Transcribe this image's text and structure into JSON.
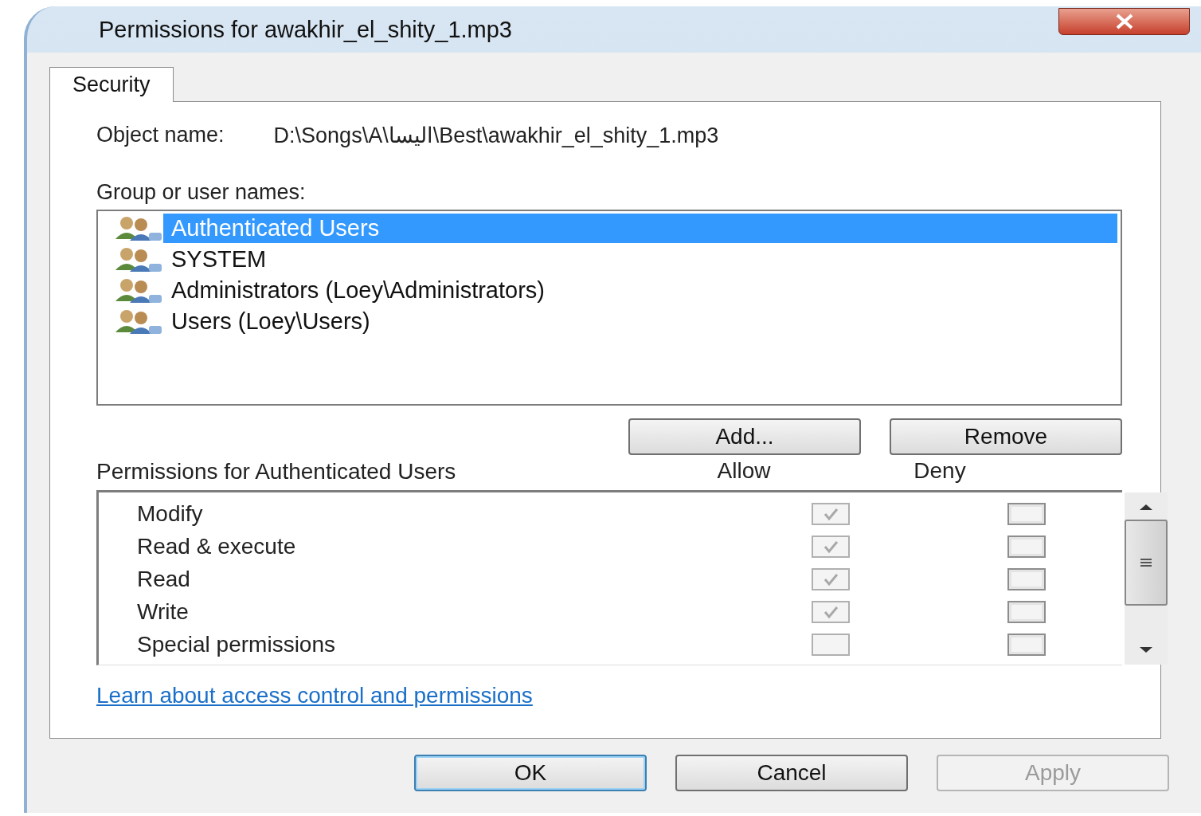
{
  "window": {
    "title": "Permissions for awakhir_el_shity_1.mp3"
  },
  "tabs": [
    {
      "label": "Security",
      "selected": true
    }
  ],
  "object_name": {
    "label": "Object name:",
    "value": "D:\\Songs\\A\\اليسا\\Best\\awakhir_el_shity_1.mp3"
  },
  "group_list": {
    "label": "Group or user names:",
    "items": [
      {
        "name": "Authenticated Users",
        "selected": true
      },
      {
        "name": "SYSTEM",
        "selected": false
      },
      {
        "name": "Administrators (Loey\\Administrators)",
        "selected": false
      },
      {
        "name": "Users (Loey\\Users)",
        "selected": false
      }
    ]
  },
  "group_buttons": [
    {
      "label": "Add...",
      "disabled": false
    },
    {
      "label": "Remove",
      "disabled": false
    }
  ],
  "permissions": {
    "label": "Permissions for Authenticated Users",
    "allow_header": "Allow",
    "deny_header": "Deny",
    "rows": [
      {
        "name": "Modify",
        "allow": true,
        "deny": false,
        "disabled": true
      },
      {
        "name": "Read & execute",
        "allow": true,
        "deny": false,
        "disabled": true
      },
      {
        "name": "Read",
        "allow": true,
        "deny": false,
        "disabled": true
      },
      {
        "name": "Write",
        "allow": true,
        "deny": false,
        "disabled": true
      },
      {
        "name": "Special permissions",
        "allow": false,
        "deny": false,
        "disabled": true
      }
    ]
  },
  "link": "Learn about access control and permissions",
  "buttons": [
    {
      "label": "OK",
      "disabled": false,
      "default": true
    },
    {
      "label": "Cancel",
      "disabled": false,
      "default": false
    },
    {
      "label": "Apply",
      "disabled": true,
      "default": false
    }
  ]
}
